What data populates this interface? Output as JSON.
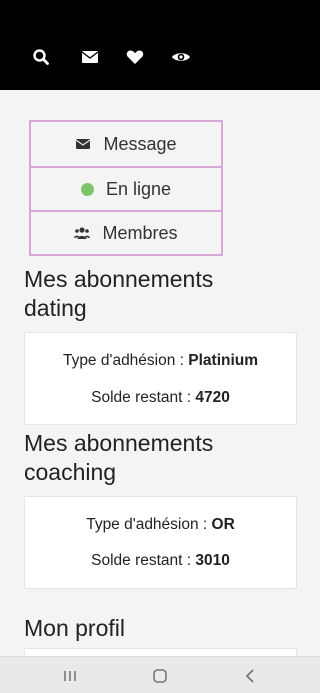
{
  "top_icons": [
    "search-icon",
    "envelope-icon",
    "heart-icon",
    "eye-icon"
  ],
  "menu": {
    "message_label": "Message",
    "online_label": "En ligne",
    "members_label": "Membres"
  },
  "dating": {
    "title": "Mes abonnements dating",
    "membership_label": "Type d'adhésion : ",
    "membership_value": "Platinium",
    "balance_label": "Solde restant : ",
    "balance_value": "4720"
  },
  "coaching": {
    "title": "Mes abonnements coaching",
    "membership_label": "Type d'adhésion : ",
    "membership_value": "OR",
    "balance_label": "Solde restant : ",
    "balance_value": "3010"
  },
  "profile": {
    "title": "Mon profil"
  },
  "colors": {
    "topbar": "#000000",
    "menu_border": "#d9a6d8",
    "online_dot": "#7cc36a"
  },
  "system_nav": [
    "recent-apps-icon",
    "home-icon",
    "back-icon"
  ]
}
